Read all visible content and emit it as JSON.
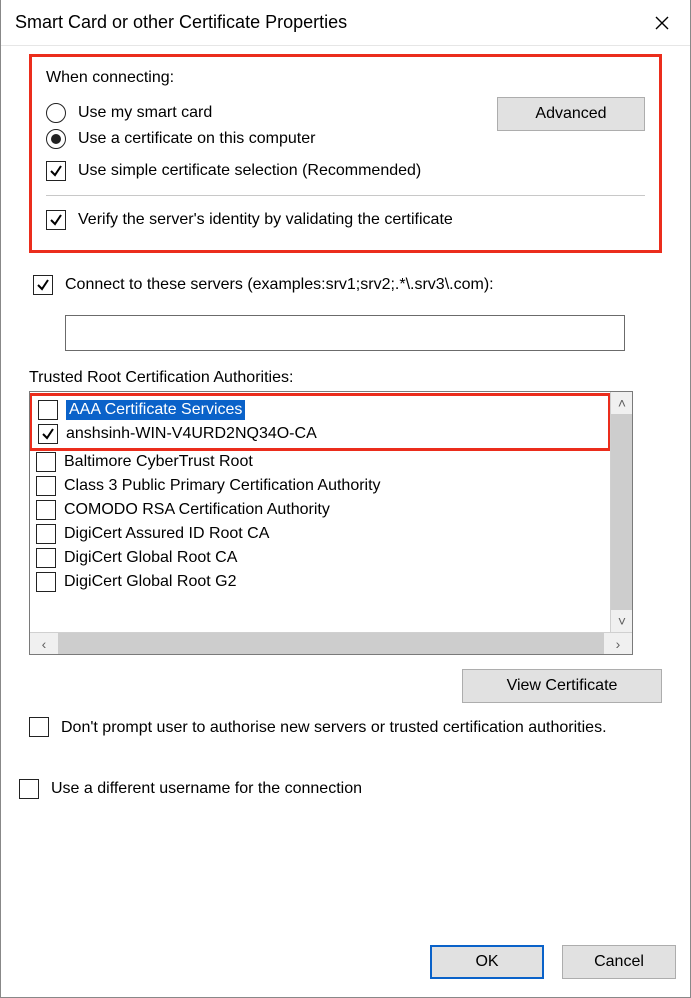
{
  "title": "Smart Card or other Certificate Properties",
  "section_connect": {
    "heading": "When connecting:",
    "radio_smartcard": "Use my smart card",
    "radio_thispc": "Use a certificate on this computer",
    "cb_simple": "Use simple certificate selection (Recommended)",
    "advanced_btn": "Advanced"
  },
  "cb_verify": "Verify the server's identity by validating the certificate",
  "cb_connect_servers": "Connect to these servers (examples:srv1;srv2;.*\\.srv3\\.com):",
  "servers_value": "",
  "trusted_label": "Trusted Root Certification Authorities:",
  "ca_list": [
    {
      "label": "AAA Certificate Services",
      "checked": false,
      "selected": true
    },
    {
      "label": "anshsinh-WIN-V4URD2NQ34O-CA",
      "checked": true,
      "selected": false
    },
    {
      "label": "Baltimore CyberTrust Root",
      "checked": false,
      "selected": false
    },
    {
      "label": "Class 3 Public Primary Certification Authority",
      "checked": false,
      "selected": false
    },
    {
      "label": "COMODO RSA Certification Authority",
      "checked": false,
      "selected": false
    },
    {
      "label": "DigiCert Assured ID Root CA",
      "checked": false,
      "selected": false
    },
    {
      "label": "DigiCert Global Root CA",
      "checked": false,
      "selected": false
    },
    {
      "label": "DigiCert Global Root G2",
      "checked": false,
      "selected": false
    }
  ],
  "view_cert_btn": "View Certificate",
  "cb_dont_prompt": "Don't prompt user to authorise new servers or trusted certification authorities.",
  "cb_use_alt_user": "Use a different username for the connection",
  "ok_btn": "OK",
  "cancel_btn": "Cancel"
}
